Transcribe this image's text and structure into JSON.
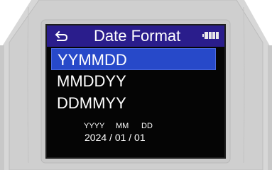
{
  "screen": {
    "title": "Date Format",
    "back_icon": "back-arrow-icon",
    "battery_icon": "battery-icon"
  },
  "menu": {
    "items": [
      {
        "label": "YYMMDD",
        "selected": true
      },
      {
        "label": "MMDDYY",
        "selected": false
      },
      {
        "label": "DDMMYY",
        "selected": false
      }
    ]
  },
  "preview": {
    "year_label": "YYYY",
    "month_label": "MM",
    "day_label": "DD",
    "value": "2024 / 01 / 01"
  },
  "colors": {
    "titlebar": "#2a1d8c",
    "selection": "#2749c9",
    "screen_bg": "#050505",
    "battery": "#e9e9e9"
  }
}
